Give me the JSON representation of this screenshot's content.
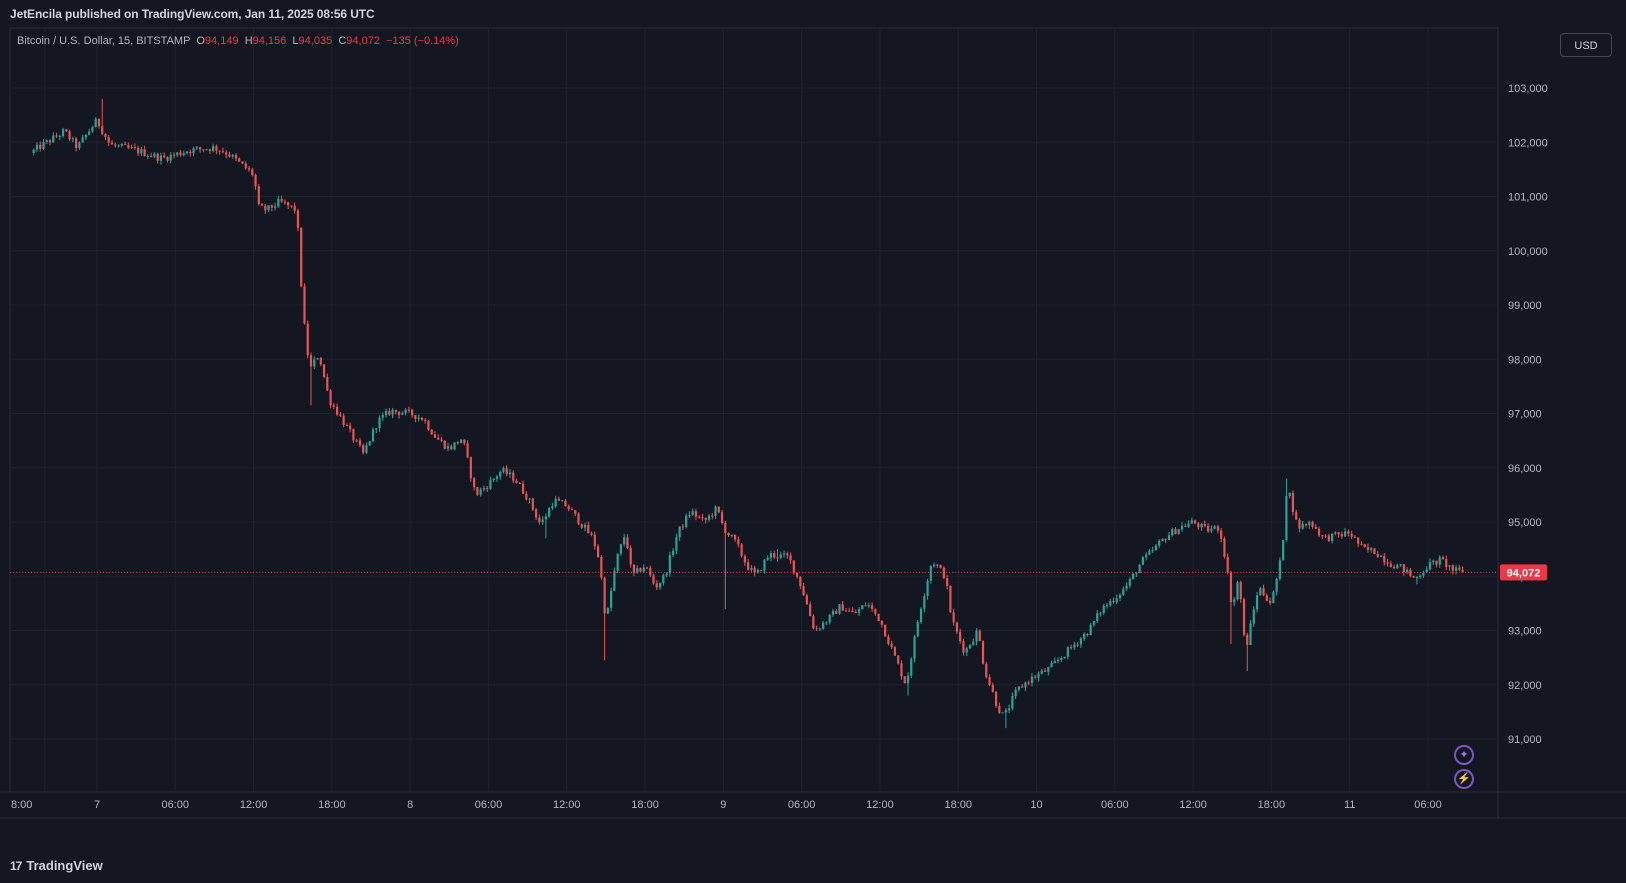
{
  "header": {
    "published": "JetEncila published on TradingView.com, Jan 11, 2025 08:56 UTC"
  },
  "legend": {
    "symbol": "Bitcoin / U.S. Dollar, 15, BITSTAMP",
    "open_label": "O",
    "open": "94,149",
    "high_label": "H",
    "high": "94,156",
    "low_label": "L",
    "low": "94,035",
    "close_label": "C",
    "close": "94,072",
    "change": "−135 (−0.14%)"
  },
  "currency_button": "USD",
  "last_price_label": "94,072",
  "footer": {
    "logo_mark": "17",
    "logo_text": "TradingView"
  },
  "icons": {
    "ai": "sparkle-icon",
    "flash": "lightning-icon",
    "logo": "tradingview-logo-icon"
  },
  "colors": {
    "background": "#131722",
    "up": "#26a69a",
    "down": "#ef5350",
    "grid": "#1e222d",
    "text": "#b2b5be",
    "price_line": "#f23645"
  },
  "chart_data": {
    "type": "candlestick",
    "symbol": "BTCUSD",
    "interval": "15",
    "y_axis_ticks": [
      "103,000",
      "102,000",
      "101,000",
      "100,000",
      "99,000",
      "98,000",
      "97,000",
      "96,000",
      "95,000",
      "94,000",
      "93,000",
      "92,000",
      "91,000"
    ],
    "y_tick_values": [
      103000,
      102000,
      101000,
      100000,
      99000,
      98000,
      97000,
      96000,
      95000,
      94000,
      93000,
      92000,
      91000
    ],
    "ylim": [
      90000,
      103800
    ],
    "x_axis_ticks": [
      "8:00",
      "7",
      "06:00",
      "12:00",
      "18:00",
      "8",
      "06:00",
      "12:00",
      "18:00",
      "9",
      "06:00",
      "12:00",
      "18:00",
      "10",
      "06:00",
      "12:00",
      "18:00",
      "11",
      "06:00"
    ],
    "x_tick_hours": [
      -4,
      0,
      6,
      12,
      18,
      24,
      30,
      36,
      42,
      48,
      54,
      60,
      66,
      72,
      78,
      84,
      90,
      96,
      102
    ],
    "last_price": 94072,
    "price_path": [
      [
        -5.1,
        101800
      ],
      [
        -4.5,
        101900
      ],
      [
        -3.5,
        102050
      ],
      [
        -2.5,
        102200
      ],
      [
        -1.5,
        101900
      ],
      [
        -0.5,
        102250
      ],
      [
        0,
        102400
      ],
      [
        1,
        101950
      ],
      [
        3,
        101850
      ],
      [
        5,
        101700
      ],
      [
        7,
        101850
      ],
      [
        9,
        101900
      ],
      [
        10,
        101800
      ],
      [
        12,
        101400
      ],
      [
        12.4,
        100800
      ],
      [
        13,
        100750
      ],
      [
        14,
        100900
      ],
      [
        15.3,
        100750
      ],
      [
        15.8,
        98800
      ],
      [
        16.3,
        97800
      ],
      [
        17,
        98100
      ],
      [
        17.8,
        97250
      ],
      [
        18.5,
        97000
      ],
      [
        19.5,
        96600
      ],
      [
        20.4,
        96250
      ],
      [
        21.5,
        96850
      ],
      [
        22.5,
        97050
      ],
      [
        24,
        97000
      ],
      [
        25,
        96900
      ],
      [
        26,
        96550
      ],
      [
        27,
        96350
      ],
      [
        28,
        96550
      ],
      [
        29,
        95500
      ],
      [
        30,
        95700
      ],
      [
        31,
        95950
      ],
      [
        32,
        95800
      ],
      [
        33,
        95450
      ],
      [
        34,
        94950
      ],
      [
        35,
        95400
      ],
      [
        36,
        95300
      ],
      [
        37,
        95000
      ],
      [
        38,
        94700
      ],
      [
        38.5,
        94300
      ],
      [
        39,
        93150
      ],
      [
        39.8,
        94300
      ],
      [
        40.5,
        94800
      ],
      [
        41,
        94000
      ],
      [
        42,
        94200
      ],
      [
        42.8,
        93800
      ],
      [
        43.5,
        94000
      ],
      [
        44.5,
        94800
      ],
      [
        45.5,
        95200
      ],
      [
        46.5,
        95000
      ],
      [
        47.5,
        95250
      ],
      [
        48,
        94900
      ],
      [
        49,
        94600
      ],
      [
        49.8,
        94200
      ],
      [
        50.5,
        94000
      ],
      [
        51.5,
        94400
      ],
      [
        53,
        94350
      ],
      [
        54,
        93800
      ],
      [
        55,
        93000
      ],
      [
        56,
        93200
      ],
      [
        57,
        93450
      ],
      [
        58,
        93300
      ],
      [
        59,
        93500
      ],
      [
        60,
        93200
      ],
      [
        61,
        92600
      ],
      [
        62,
        92000
      ],
      [
        63,
        93300
      ],
      [
        64,
        94300
      ],
      [
        65,
        94000
      ],
      [
        65.5,
        93200
      ],
      [
        66.5,
        92600
      ],
      [
        67.5,
        93000
      ],
      [
        68,
        92300
      ],
      [
        69,
        91600
      ],
      [
        69.5,
        91400
      ],
      [
        70.5,
        91900
      ],
      [
        71.5,
        92100
      ],
      [
        73,
        92300
      ],
      [
        74.5,
        92650
      ],
      [
        76,
        93000
      ],
      [
        77,
        93400
      ],
      [
        78,
        93600
      ],
      [
        79,
        93850
      ],
      [
        80,
        94250
      ],
      [
        81,
        94500
      ],
      [
        82,
        94750
      ],
      [
        83,
        94900
      ],
      [
        84,
        95000
      ],
      [
        85,
        94850
      ],
      [
        86,
        94900
      ],
      [
        86.5,
        94300
      ],
      [
        87,
        93400
      ],
      [
        87.5,
        94000
      ],
      [
        88,
        92600
      ],
      [
        89,
        93800
      ],
      [
        90,
        93500
      ],
      [
        90.8,
        94400
      ],
      [
        91.2,
        95700
      ],
      [
        92,
        94900
      ],
      [
        93,
        95000
      ],
      [
        94,
        94700
      ],
      [
        95,
        94750
      ],
      [
        96,
        94800
      ],
      [
        97,
        94500
      ],
      [
        98,
        94450
      ],
      [
        99,
        94250
      ],
      [
        100,
        94150
      ],
      [
        101,
        93950
      ],
      [
        102,
        94200
      ],
      [
        103,
        94300
      ],
      [
        104,
        94100
      ],
      [
        104.7,
        94072
      ]
    ],
    "spikes": [
      [
        0.3,
        102800
      ],
      [
        15.9,
        99000
      ],
      [
        16.5,
        97150
      ],
      [
        34.3,
        94700
      ],
      [
        39.0,
        92450
      ],
      [
        48.2,
        93400
      ],
      [
        52.2,
        94500
      ],
      [
        62.1,
        91800
      ],
      [
        69.6,
        91200
      ],
      [
        87.0,
        92750
      ],
      [
        88.2,
        92250
      ],
      [
        91.1,
        95800
      ],
      [
        101.2,
        93850
      ]
    ]
  }
}
